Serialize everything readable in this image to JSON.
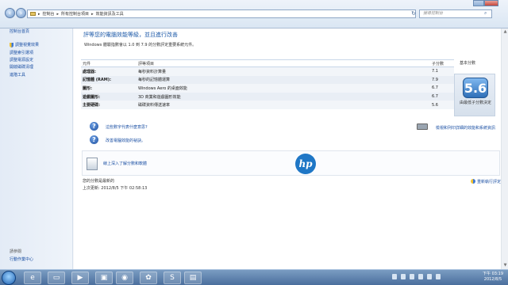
{
  "address_bar": {
    "breadcrumb": [
      "控制台",
      "所有控制台項目",
      "效能資訊及工具"
    ],
    "search_placeholder": "搜尋控制台"
  },
  "sidebar": {
    "home": "控制台首頁",
    "items": [
      {
        "label": "調整視覺效果"
      },
      {
        "label": "調整索引選項"
      },
      {
        "label": "調整電源設定"
      },
      {
        "label": "開啟磁碟清理"
      },
      {
        "label": "進階工具"
      }
    ],
    "see_also": "請參閱",
    "action_center": "行動作業中心"
  },
  "main": {
    "title": "評等您的電腦效能等級，並且進行改善",
    "subtitle": "Windows 體驗指數會以 1.0 到 7.9 的分數評定重要系統元件。",
    "table": {
      "headers": [
        "元件",
        "評等項目",
        "子分數"
      ],
      "base_header": "基本分數",
      "rows": [
        {
          "component": "處理器:",
          "item": "每秒資料計算量",
          "score": "7.1"
        },
        {
          "component": "記憶體 (RAM):",
          "item": "每秒的記憶體運算",
          "score": "7.9"
        },
        {
          "component": "圖形:",
          "item": "Windows Aero 的桌面效能",
          "score": "6.7"
        },
        {
          "component": "遊戲圖形:",
          "item": "3D 商業和遊戲圖形效能",
          "score": "6.7"
        },
        {
          "component": "主要硬碟:",
          "item": "磁碟資料傳送速率",
          "score": "5.6"
        }
      ]
    },
    "base_score": "5.6",
    "base_caption": "由最低子分數決定",
    "links": {
      "what_means": "這些數字代表什麼意思?",
      "tips": "改善電腦效能的祕訣。",
      "print": "檢視和列印詳細的效能和系統資訊",
      "learn": "線上深入了解分數和軟體"
    },
    "status_current": "您的分數是最新的",
    "status_updated": "上次更新: 2012/8/5 下午 02:58:13",
    "rerun": "重新執行評定"
  },
  "taskbar": {
    "time": "下午 03:19",
    "date": "2012/8/5"
  }
}
